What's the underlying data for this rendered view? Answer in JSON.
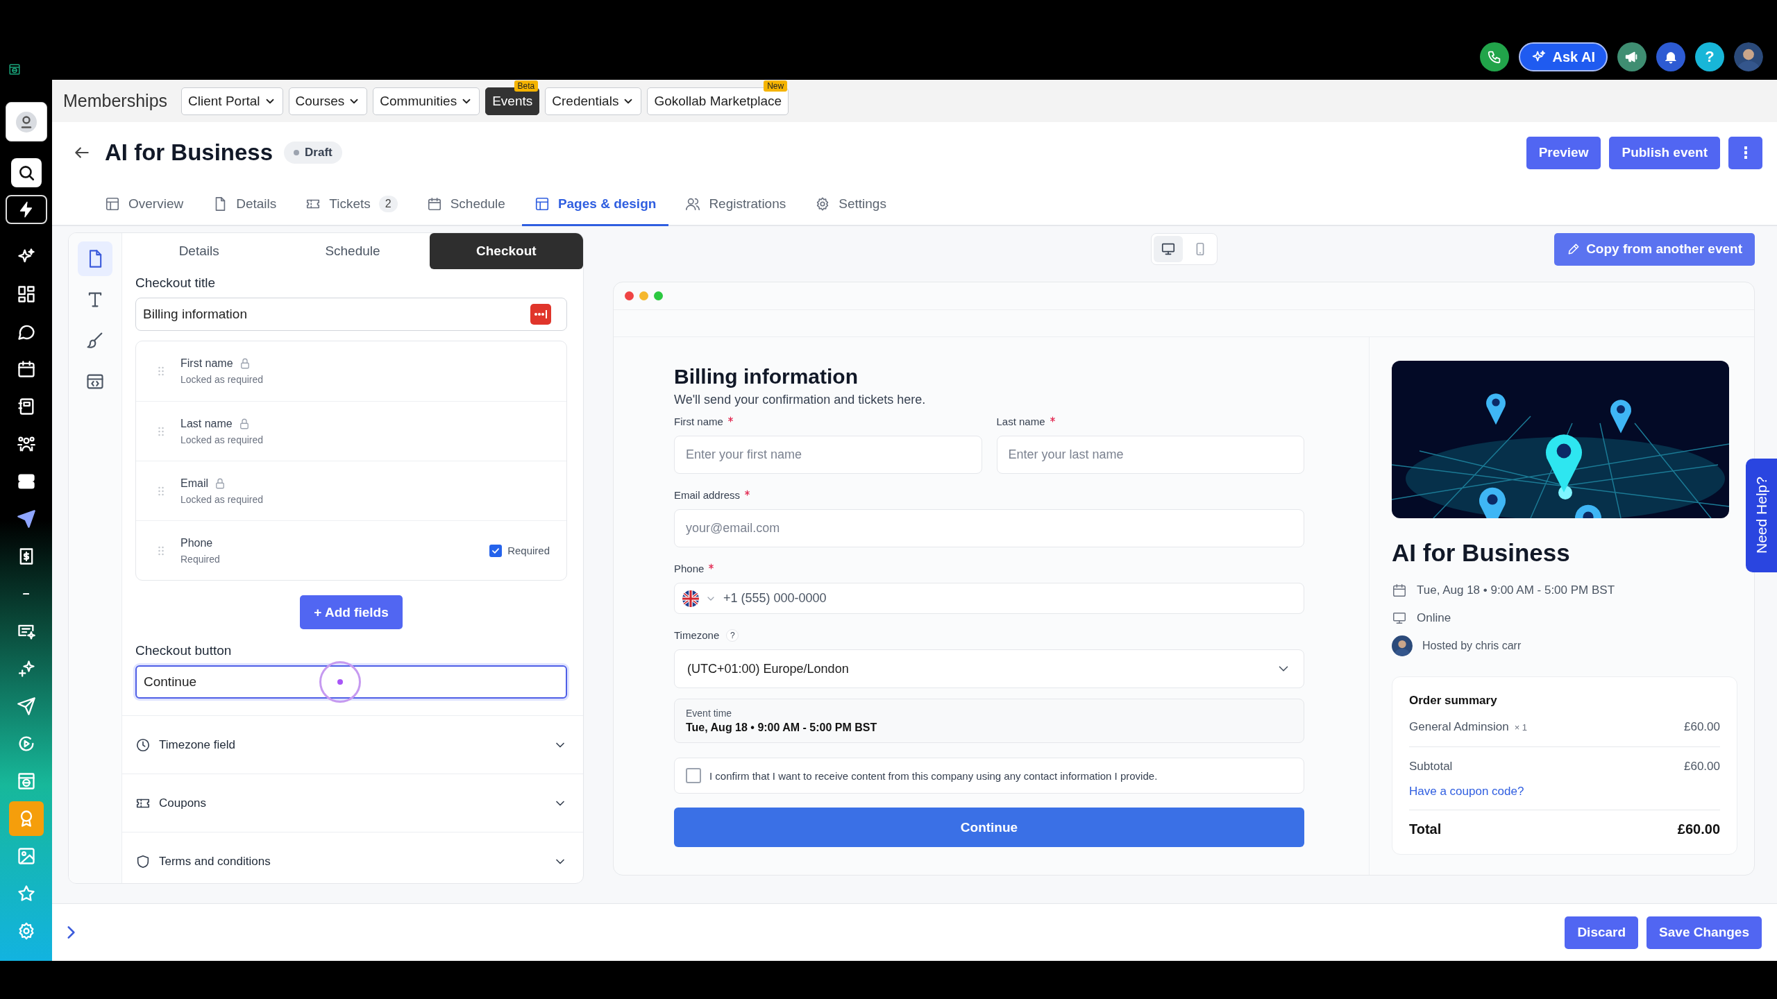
{
  "top_bar": {
    "ask_ai": "Ask AI",
    "help": "?"
  },
  "sidebar": {
    "items": [
      {
        "selected": false
      },
      {
        "selected": false
      },
      {
        "selected": false
      },
      {
        "selected": false
      },
      {
        "selected": false
      },
      {
        "selected": false
      },
      {
        "selected": false
      },
      {
        "selected": false
      },
      {
        "selected": false
      },
      {
        "selected": false
      },
      {
        "selected": false
      },
      {
        "selected": false
      },
      {
        "selected": false
      },
      {
        "selected": false
      },
      {
        "selected": false
      },
      {
        "selected": true
      },
      {
        "selected": false
      },
      {
        "selected": false
      },
      {
        "selected": false
      }
    ]
  },
  "product_nav": {
    "title": "Memberships",
    "items": [
      {
        "label": "Client Portal",
        "dropdown": true,
        "selected": false
      },
      {
        "label": "Courses",
        "dropdown": true,
        "selected": false
      },
      {
        "label": "Communities",
        "dropdown": true,
        "selected": false
      },
      {
        "label": "Events",
        "dropdown": false,
        "selected": true,
        "badge": "Beta"
      },
      {
        "label": "Credentials",
        "dropdown": true,
        "selected": false
      },
      {
        "label": "Gokollab Marketplace",
        "dropdown": false,
        "selected": false,
        "badge": "New"
      }
    ]
  },
  "event_header": {
    "title": "AI for Business",
    "status": "Draft",
    "actions": [
      "Preview",
      "Publish event"
    ]
  },
  "tabs": [
    {
      "label": "Overview",
      "selected": false
    },
    {
      "label": "Details",
      "selected": false
    },
    {
      "label": "Tickets",
      "count": "2",
      "selected": false
    },
    {
      "label": "Schedule",
      "selected": false
    },
    {
      "label": "Pages & design",
      "selected": true
    },
    {
      "label": "Registrations",
      "selected": false
    },
    {
      "label": "Settings",
      "selected": false
    }
  ],
  "editor": {
    "tools": [
      {
        "selected": true
      },
      {
        "selected": false
      },
      {
        "selected": false
      },
      {
        "selected": false
      }
    ],
    "sub_tabs": [
      {
        "label": "Details",
        "selected": false
      },
      {
        "label": "Schedule",
        "selected": false
      },
      {
        "label": "Checkout",
        "selected": true
      }
    ],
    "checkout_title_label": "Checkout title",
    "checkout_title": "Billing information",
    "fields": [
      {
        "name": "First name",
        "note": "Locked as required",
        "kind": "locked"
      },
      {
        "name": "Last name",
        "note": "Locked as required",
        "kind": "locked"
      },
      {
        "name": "Email",
        "note": "Locked as required",
        "kind": "locked"
      },
      {
        "name": "Phone",
        "note": "Required",
        "kind": "toggle",
        "checked": true,
        "toggle_label": "Required"
      }
    ],
    "add_fields": "+ Add fields",
    "checkout_button_label": "Checkout button",
    "checkout_button": "Continue",
    "checkout_button_focused": true,
    "sections": [
      {
        "label": "Timezone field",
        "expanded": false
      },
      {
        "label": "Coupons",
        "expanded": false
      },
      {
        "label": "Terms and conditions",
        "expanded": false
      }
    ]
  },
  "preview": {
    "devices": [
      {
        "selected": true
      },
      {
        "selected": false
      }
    ],
    "copy_button": "Copy from another event",
    "form": {
      "heading": "Billing information",
      "subheading": "We'll send your confirmation and tickets here.",
      "fields": [
        {
          "label": "First name",
          "required": true,
          "placeholder": "Enter your first name",
          "kind": "text"
        },
        {
          "label": "Last name",
          "required": true,
          "placeholder": "Enter your last name",
          "kind": "text"
        },
        {
          "label": "Email address",
          "required": true,
          "placeholder": "your@email.com",
          "kind": "text"
        },
        {
          "label": "Phone",
          "required": true,
          "placeholder": "+1 (555) 000-0000",
          "kind": "phone"
        },
        {
          "label": "Timezone",
          "required": false,
          "help": "?",
          "value": "(UTC+01:00) Europe/London",
          "kind": "select"
        }
      ],
      "event_time": {
        "label": "Event time",
        "value": "Tue, Aug 18 • 9:00 AM - 5:00 PM BST"
      },
      "consent": {
        "text": "I confirm that I want to receive content from this company using any contact information I provide.",
        "checked": false
      },
      "submit": "Continue"
    },
    "event_card": {
      "title": "AI for Business",
      "date": "Tue, Aug 18 • 9:00 AM - 5:00 PM BST",
      "location": "Online",
      "host": "Hosted by chris carr"
    },
    "order_summary": {
      "title": "Order summary",
      "items": [
        {
          "name": "General Adminsion",
          "qty": "× 1",
          "price": "£60.00"
        }
      ],
      "subtotal": {
        "label": "Subtotal",
        "amount": "£60.00"
      },
      "coupon_link": "Have a coupon code?",
      "total": {
        "label": "Total",
        "amount": "£60.00"
      }
    }
  },
  "need_help": "Need Help?",
  "footer": {
    "buttons": [
      "Discard",
      "Save Changes"
    ]
  }
}
